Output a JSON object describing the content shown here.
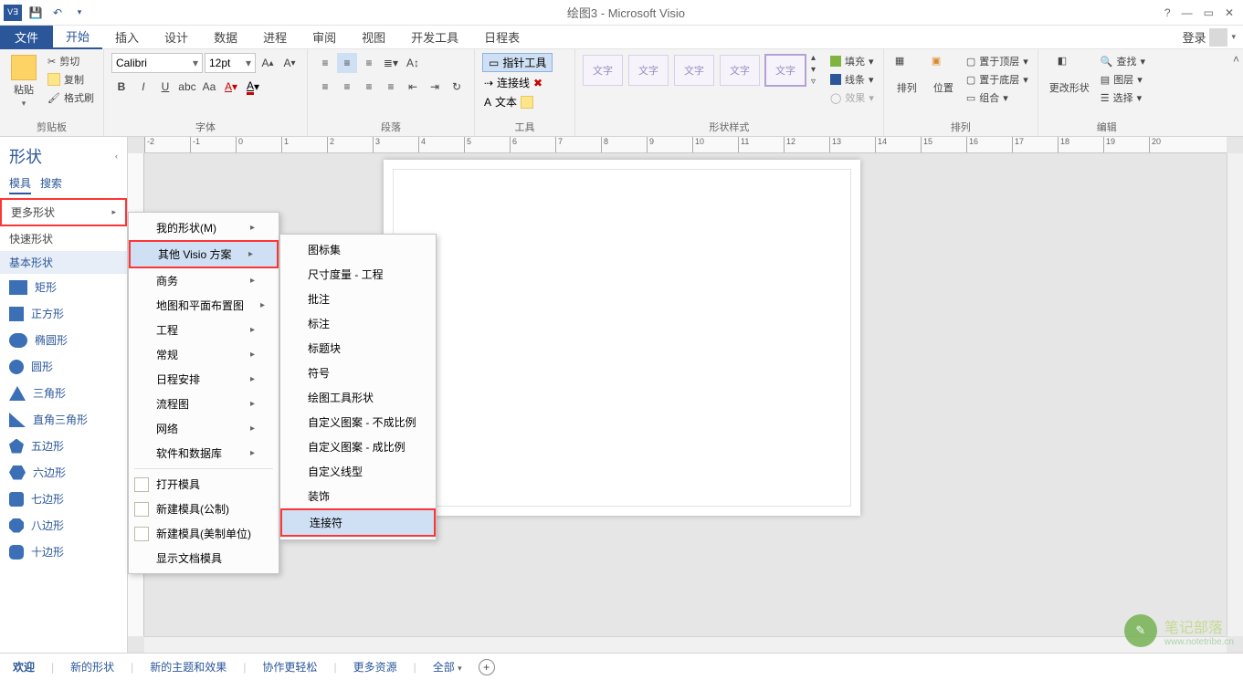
{
  "title": "绘图3 - Microsoft Visio",
  "menubar": {
    "file": "文件",
    "tabs": [
      "开始",
      "插入",
      "设计",
      "数据",
      "进程",
      "审阅",
      "视图",
      "开发工具",
      "日程表"
    ],
    "login": "登录"
  },
  "ribbon": {
    "clipboard": {
      "paste": "粘贴",
      "cut": "剪切",
      "copy": "复制",
      "format": "格式刷",
      "label": "剪贴板"
    },
    "font": {
      "name": "Calibri",
      "size": "12pt",
      "label": "字体"
    },
    "paragraph": {
      "label": "段落"
    },
    "tools": {
      "pointer": "指针工具",
      "connector": "连接线",
      "text": "文本",
      "label": "工具"
    },
    "shapeStyles": {
      "thumb": "文字",
      "fill": "填充",
      "line": "线条",
      "effect": "效果",
      "label": "形状样式"
    },
    "arrange": {
      "arrange": "排列",
      "position": "位置",
      "front": "置于顶层",
      "back": "置于底层",
      "group": "组合",
      "label": "排列"
    },
    "editing": {
      "change": "更改形状",
      "find": "查找",
      "layer": "图层",
      "select": "选择",
      "label": "编辑"
    }
  },
  "shapesPane": {
    "title": "形状",
    "tab1": "模具",
    "tab2": "搜索",
    "moreShapes": "更多形状",
    "quickShapes": "快速形状",
    "basicShapes": "基本形状",
    "shapes": [
      "矩形",
      "正方形",
      "椭圆形",
      "圆形",
      "三角形",
      "直角三角形",
      "五边形",
      "六边形",
      "七边形",
      "八边形",
      "十边形"
    ]
  },
  "menu1": {
    "items": [
      {
        "label": "我的形状(M)",
        "arrow": true
      },
      {
        "label": "其他 Visio 方案",
        "arrow": true,
        "hov": true,
        "red": true
      },
      {
        "label": "商务",
        "arrow": true
      },
      {
        "label": "地图和平面布置图",
        "arrow": true
      },
      {
        "label": "工程",
        "arrow": true
      },
      {
        "label": "常规",
        "arrow": true
      },
      {
        "label": "日程安排",
        "arrow": true
      },
      {
        "label": "流程图",
        "arrow": true
      },
      {
        "label": "网络",
        "arrow": true
      },
      {
        "label": "软件和数据库",
        "arrow": true
      }
    ],
    "sep": true,
    "items2": [
      {
        "label": "打开模具",
        "icon": true
      },
      {
        "label": "新建模具(公制)",
        "icon": true
      },
      {
        "label": "新建模具(美制单位)",
        "icon": true
      },
      {
        "label": "显示文档模具"
      }
    ]
  },
  "menu2": {
    "items": [
      "图标集",
      "尺寸度量 - 工程",
      "批注",
      "标注",
      "标题块",
      "符号",
      "绘图工具形状",
      "自定义图案 - 不成比例",
      "自定义图案 - 成比例",
      "自定义线型",
      "装饰"
    ],
    "highlighted": "连接符"
  },
  "statusbar": {
    "items": [
      "欢迎",
      "新的形状",
      "新的主题和效果",
      "协作更轻松",
      "更多资源",
      "全部"
    ]
  },
  "watermark": {
    "brand": "笔记部落",
    "url": "www.notetribe.cn"
  }
}
